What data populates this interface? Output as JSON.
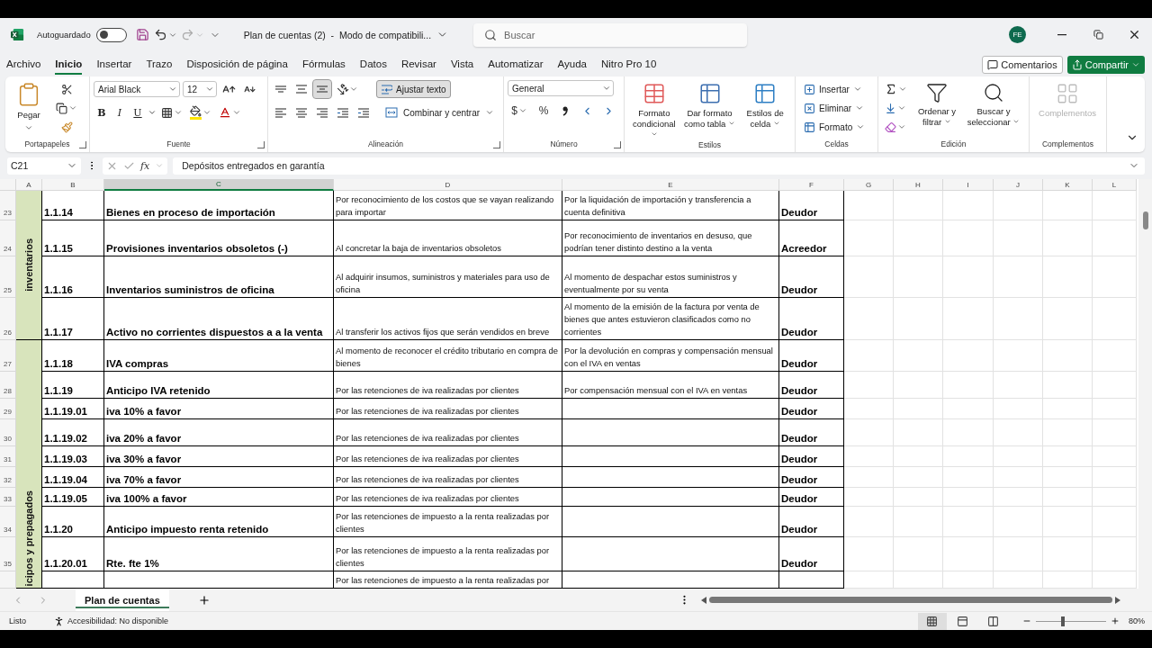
{
  "title_bar": {
    "autosave_label": "Autoguardado",
    "autosave_on": false,
    "document_title": "Plan de cuentas (2)  -  Modo de compatibili...",
    "search": {
      "placeholder": "Buscar"
    },
    "avatar": "FE"
  },
  "menu_tabs": [
    {
      "label": "Archivo",
      "selected": false
    },
    {
      "label": "Inicio",
      "selected": true
    },
    {
      "label": "Insertar",
      "selected": false
    },
    {
      "label": "Trazo",
      "selected": false
    },
    {
      "label": "Disposición de página",
      "selected": false
    },
    {
      "label": "Fórmulas",
      "selected": false
    },
    {
      "label": "Datos",
      "selected": false
    },
    {
      "label": "Revisar",
      "selected": false
    },
    {
      "label": "Vista",
      "selected": false
    },
    {
      "label": "Automatizar",
      "selected": false
    },
    {
      "label": "Ayuda",
      "selected": false
    },
    {
      "label": "Nitro Pro 10",
      "selected": false
    }
  ],
  "comments_button": "Comentarios",
  "share_button": "Compartir",
  "ribbon": {
    "clipboard": {
      "paste": "Pegar",
      "group": "Portapapeles"
    },
    "font": {
      "family": "Arial Black",
      "size": "12",
      "styles": [
        "B",
        "I",
        "U"
      ],
      "group": "Fuente"
    },
    "alignment": {
      "vertical": [
        {
          "kind": "top",
          "selected": false
        },
        {
          "kind": "middle",
          "selected": false
        },
        {
          "kind": "bottom",
          "selected": true
        }
      ],
      "wrap": "Ajustar texto",
      "wrap_on": true,
      "merge": "Combinar y centrar",
      "group": "Alineación"
    },
    "number": {
      "format": "General",
      "currency": "$",
      "percent": "%",
      "group": "Número"
    },
    "styles": {
      "buttons": [
        "Formato condicional",
        "Dar formato como tabla",
        "Estilos de celda"
      ],
      "group": "Estilos"
    },
    "cells": {
      "buttons": [
        "Insertar",
        "Eliminar",
        "Formato"
      ],
      "group": "Celdas"
    },
    "editing": {
      "buttons": [
        "Ordenar y filtrar",
        "Buscar y seleccionar"
      ],
      "group": "Edición"
    },
    "addins": {
      "button": "Complementos",
      "disabled": true,
      "group": "Complementos"
    }
  },
  "formula_bar": {
    "cell_ref": "C21",
    "fx": "fx",
    "value": "Depósitos entregados en garantía"
  },
  "sheet": {
    "columns": [
      {
        "label": "A",
        "selected": false
      },
      {
        "label": "B",
        "selected": false
      },
      {
        "label": "C",
        "selected": true
      },
      {
        "label": "D",
        "selected": false
      },
      {
        "label": "E",
        "selected": false
      },
      {
        "label": "F",
        "selected": false
      },
      {
        "label": "G",
        "selected": false
      },
      {
        "label": "H",
        "selected": false
      },
      {
        "label": "I",
        "selected": false
      },
      {
        "label": "J",
        "selected": false
      },
      {
        "label": "K",
        "selected": false
      },
      {
        "label": "L",
        "selected": false
      }
    ],
    "groups": [
      {
        "label": "inventarios",
        "rows": [
          {
            "row": "23",
            "b": "1.1.14",
            "c": "Bienes en proceso de importación",
            "d": "Por reconocimiento de los costos que se vayan realizando para importar",
            "e": "Por la liquidación de importación y transferencia a cuenta definitiva",
            "f": "Deudor"
          },
          {
            "row": "24",
            "b": "1.1.15",
            "c": "Provisiones inventarios obsoletos (-)",
            "d": "Al concretar la baja de inventarios obsoletos",
            "e": "Por reconocimiento de inventarios en desuso, que podrían tener distinto destino a la venta",
            "f": "Acreedor"
          },
          {
            "row": "25",
            "b": "1.1.16",
            "c": "Inventarios suministros de oficina",
            "d": "Al adquirir insumos, suministros y materiales para uso de oficina",
            "e": "Al momento de despachar estos suministros y eventualmente por su venta",
            "f": "Deudor"
          },
          {
            "row": "26",
            "b": "1.1.17",
            "c": "Activo no corrientes dispuestos a a la venta",
            "d": "Al transferir los activos fijos que serán vendidos en breve",
            "e": "Al momento de la emisión de la factura por venta de bienes que antes estuvieron clasificados como no corrientes",
            "f": "Deudor"
          }
        ]
      },
      {
        "label": "icipos y prepagados",
        "rows": [
          {
            "row": "27",
            "b": "1.1.18",
            "c": "IVA compras",
            "d": "Al momento de reconocer el crédito tributario en compra de bienes",
            "e": "Por la devolución en compras y compensación mensual con el IVA en ventas",
            "f": "Deudor"
          },
          {
            "row": "28",
            "b": "1.1.19",
            "c": "Anticipo IVA retenido",
            "d": "Por las retenciones de iva realizadas por clientes",
            "e": "Por compensación mensual con el IVA en ventas",
            "f": "Deudor"
          },
          {
            "row": "29",
            "b": "1.1.19.01",
            "c": "iva 10% a favor",
            "d": "Por las retenciones de iva realizadas por clientes",
            "f": "Deudor"
          },
          {
            "row": "30",
            "b": "1.1.19.02",
            "c": "iva 20% a favor",
            "d": "Por las retenciones de iva realizadas por clientes",
            "f": "Deudor"
          },
          {
            "row": "31",
            "b": "1.1.19.03",
            "c": "iva 30% a favor",
            "d": "Por las retenciones de iva realizadas por clientes",
            "f": "Deudor"
          },
          {
            "row": "32",
            "b": "1.1.19.04",
            "c": "iva 70% a favor",
            "d": "Por las retenciones de iva realizadas por clientes",
            "f": "Deudor"
          },
          {
            "row": "33",
            "b": "1.1.19.05",
            "c": "iva 100% a favor",
            "d": "Por las retenciones de iva realizadas por clientes",
            "f": "Deudor"
          },
          {
            "row": "34",
            "b": "1.1.20",
            "c": "Anticipo impuesto renta retenido",
            "d": "Por las retenciones de impuesto a la renta realizadas por clientes",
            "f": "Deudor"
          },
          {
            "row": "35",
            "b": "1.1.20.01",
            "c": "Rte. fte 1%",
            "d": "Por las retenciones de impuesto a la renta realizadas por clientes",
            "f": "Deudor"
          },
          {
            "d": "Por las retenciones de impuesto a la renta realizadas por"
          }
        ]
      }
    ]
  },
  "sheet_tabs": [
    {
      "label": "Plan de cuentas",
      "selected": true
    }
  ],
  "status_bar": {
    "status": "Listo",
    "accessibility": "Accesibilidad: No disponible",
    "views": [
      {
        "kind": "normal",
        "selected": true
      },
      {
        "kind": "page_layout",
        "selected": false
      },
      {
        "kind": "page_break",
        "selected": false
      }
    ],
    "zoom": {
      "level": 0.39,
      "reading": "80%"
    }
  }
}
